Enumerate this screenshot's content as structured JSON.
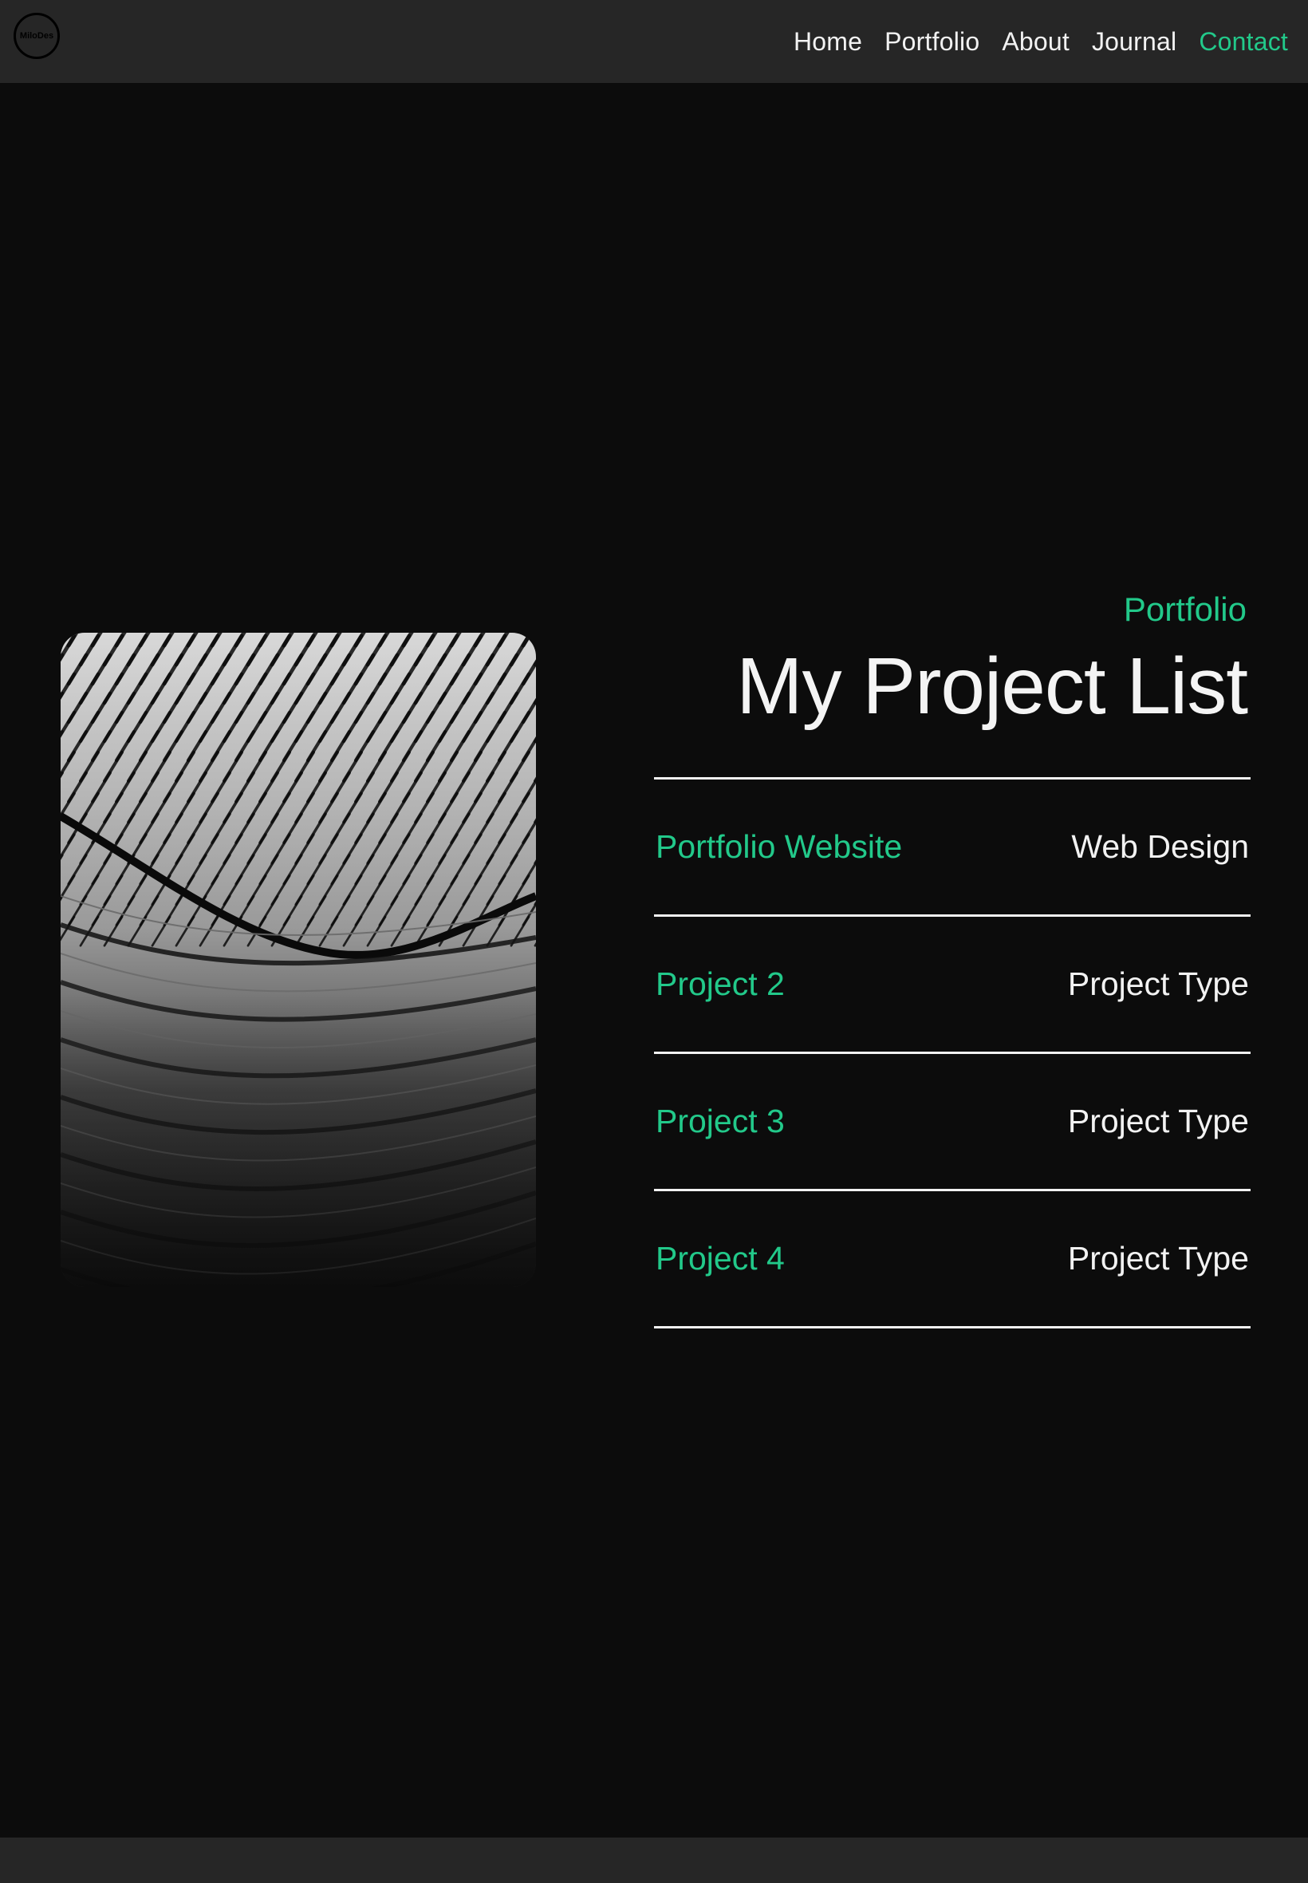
{
  "header": {
    "logo_text": "MiloDes",
    "nav": [
      {
        "label": "Home"
      },
      {
        "label": "Portfolio"
      },
      {
        "label": "About"
      },
      {
        "label": "Journal"
      },
      {
        "label": "Contact",
        "active": true
      }
    ]
  },
  "hero": {
    "eyebrow": "Portfolio",
    "title": "My Project List"
  },
  "projects": [
    {
      "name": "Portfolio Website",
      "type": "Web Design"
    },
    {
      "name": "Project 2",
      "type": "Project Type"
    },
    {
      "name": "Project 3",
      "type": "Project Type"
    },
    {
      "name": "Project 4",
      "type": "Project Type"
    }
  ],
  "colors": {
    "accent": "#22c98a",
    "background": "#0c0c0c",
    "header": "#262626",
    "text": "#f2f2f2"
  }
}
